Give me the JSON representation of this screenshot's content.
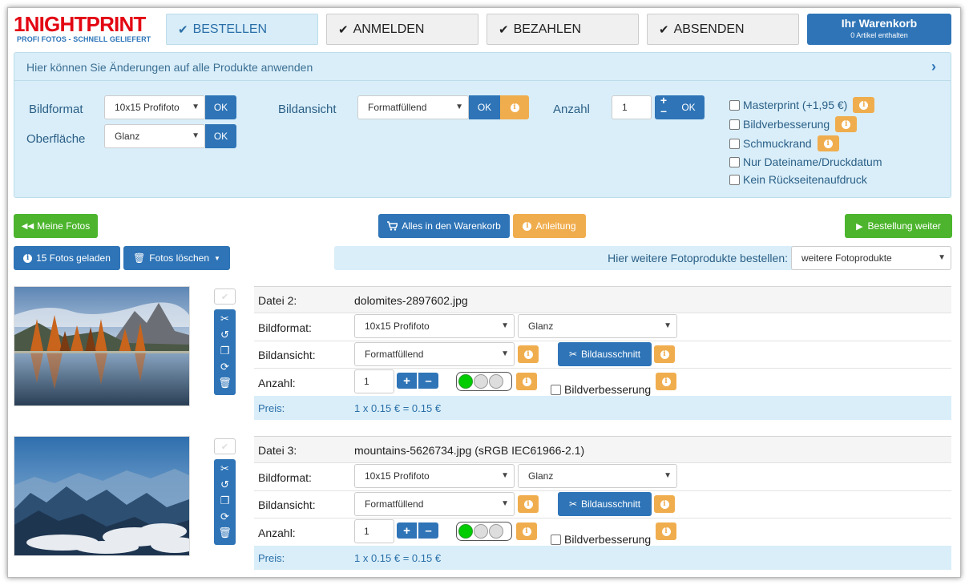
{
  "logo": {
    "title": "1NIGHTPRINT",
    "subtitle": "PROFI FOTOS - SCHNELL GELIEFERT"
  },
  "steps": [
    {
      "label": "BESTELLEN",
      "active": true
    },
    {
      "label": "ANMELDEN",
      "active": false
    },
    {
      "label": "BEZAHLEN",
      "active": false
    },
    {
      "label": "ABSENDEN",
      "active": false
    }
  ],
  "cart": {
    "title": "Ihr Warenkorb",
    "count_text": "0 Artikel enthalten"
  },
  "global_panel": {
    "header": "Hier können Sie Änderungen auf alle Produkte anwenden",
    "bildformat_label": "Bildformat",
    "bildformat_value": "10x15 Profifoto",
    "oberflaeche_label": "Oberfläche",
    "oberflaeche_value": "Glanz",
    "bildansicht_label": "Bildansicht",
    "bildansicht_value": "Formatfüllend",
    "anzahl_label": "Anzahl",
    "anzahl_value": "1",
    "ok_label": "OK",
    "options": [
      {
        "label": "Masterprint (+1,95 €)",
        "info": true
      },
      {
        "label": "Bildverbesserung",
        "info": true
      },
      {
        "label": "Schmuckrand",
        "info": true
      },
      {
        "label": "Nur Dateiname/Druckdatum",
        "info": false
      },
      {
        "label": "Kein Rückseitenaufdruck",
        "info": false
      }
    ]
  },
  "actions": {
    "meine_fotos": "Meine Fotos",
    "alles_warenkorb": "Alles in den Warenkorb",
    "anleitung": "Anleitung",
    "bestellung_weiter": "Bestellung weiter",
    "fotos_geladen": "15 Fotos geladen",
    "fotos_loeschen": "Fotos löschen",
    "weitere_label": "Hier weitere Fotoprodukte bestellen:",
    "weitere_value": "weitere Fotoprodukte"
  },
  "items": [
    {
      "datei_label": "Datei 2:",
      "filename": "dolomites-2897602.jpg",
      "bildformat_label": "Bildformat:",
      "format": "10x15 Profifoto",
      "surface": "Glanz",
      "bildansicht_label": "Bildansicht:",
      "view": "Formatfüllend",
      "crop_label": "Bildausschnitt",
      "anzahl_label": "Anzahl:",
      "qty": "1",
      "enhance_label": "Bildverbesserung",
      "preis_label": "Preis:",
      "price": "1 x 0.15 € = 0.15 €",
      "quality_level": 1,
      "image": "dolomites"
    },
    {
      "datei_label": "Datei 3:",
      "filename": "mountains-5626734.jpg (sRGB IEC61966-2.1)",
      "bildformat_label": "Bildformat:",
      "format": "10x15 Profifoto",
      "surface": "Glanz",
      "bildansicht_label": "Bildansicht:",
      "view": "Formatfüllend",
      "crop_label": "Bildausschnitt",
      "anzahl_label": "Anzahl:",
      "qty": "1",
      "enhance_label": "Bildverbesserung",
      "preis_label": "Preis:",
      "price": "1 x 0.15 € = 0.15 €",
      "quality_level": 1,
      "image": "mountains"
    }
  ],
  "colors": {
    "primary": "#2e74b7",
    "success": "#4cb52d",
    "warning": "#f0ad4e",
    "brand_red": "#e30613",
    "panel_bg": "#d9eef9"
  }
}
